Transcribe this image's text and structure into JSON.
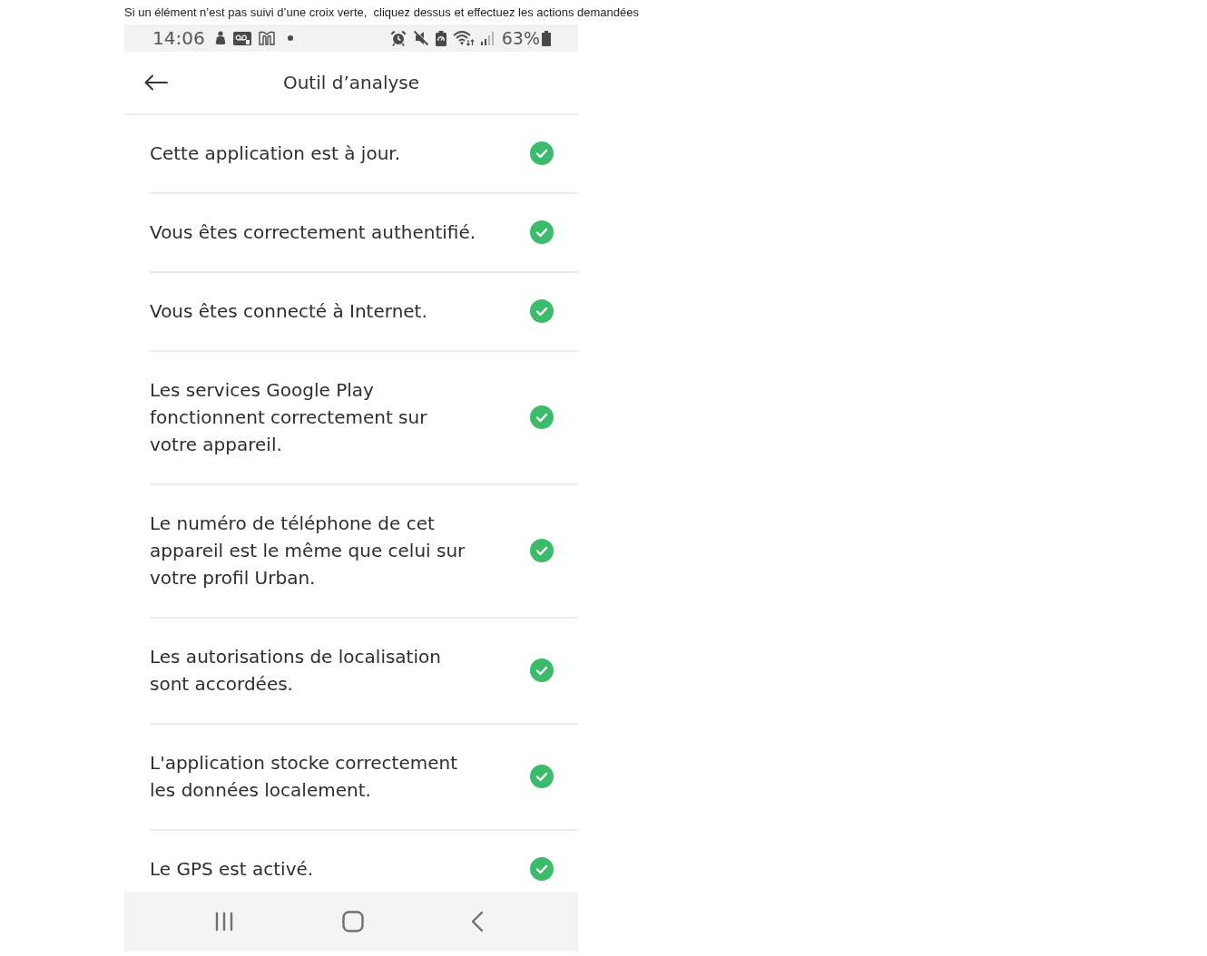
{
  "caption": "Si un élément n’est pas suivi d’une croix verte,  cliquez dessus et effectuez les actions demandées",
  "status_bar": {
    "time": "14:06",
    "battery_percent": "63%"
  },
  "header": {
    "title": "Outil d’analyse"
  },
  "checks": [
    {
      "text": "Cette application est à jour.",
      "ok": true
    },
    {
      "text": "Vous êtes correctement authentifié.",
      "ok": true
    },
    {
      "text": "Vous êtes connecté à Internet.",
      "ok": true
    },
    {
      "text": "Les services Google Play\nfonctionnent correctement sur\nvotre appareil.",
      "ok": true
    },
    {
      "text": "Le numéro de téléphone de cet\nappareil est le même que celui sur\nvotre profil Urban.",
      "ok": true
    },
    {
      "text": "Les autorisations de localisation\nsont accordées.",
      "ok": true
    },
    {
      "text": "L'application stocke correctement\nles données localement.",
      "ok": true
    },
    {
      "text": "Le GPS est activé.",
      "ok": true
    }
  ]
}
